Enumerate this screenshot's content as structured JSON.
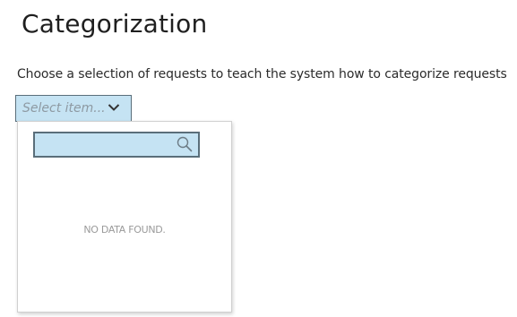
{
  "page": {
    "title": "Categorization",
    "description": "Choose a selection of requests to teach the system how to categorize requests"
  },
  "select": {
    "placeholder": "Select item...",
    "icon": "chevron-down-icon"
  },
  "dropdown": {
    "search": {
      "value": "",
      "placeholder": "",
      "icon": "search-icon"
    },
    "empty_message": "NO DATA FOUND."
  },
  "colors": {
    "field_background": "#c5e3f3",
    "field_border": "#5a6e7a",
    "empty_text": "#9a9a9a"
  }
}
